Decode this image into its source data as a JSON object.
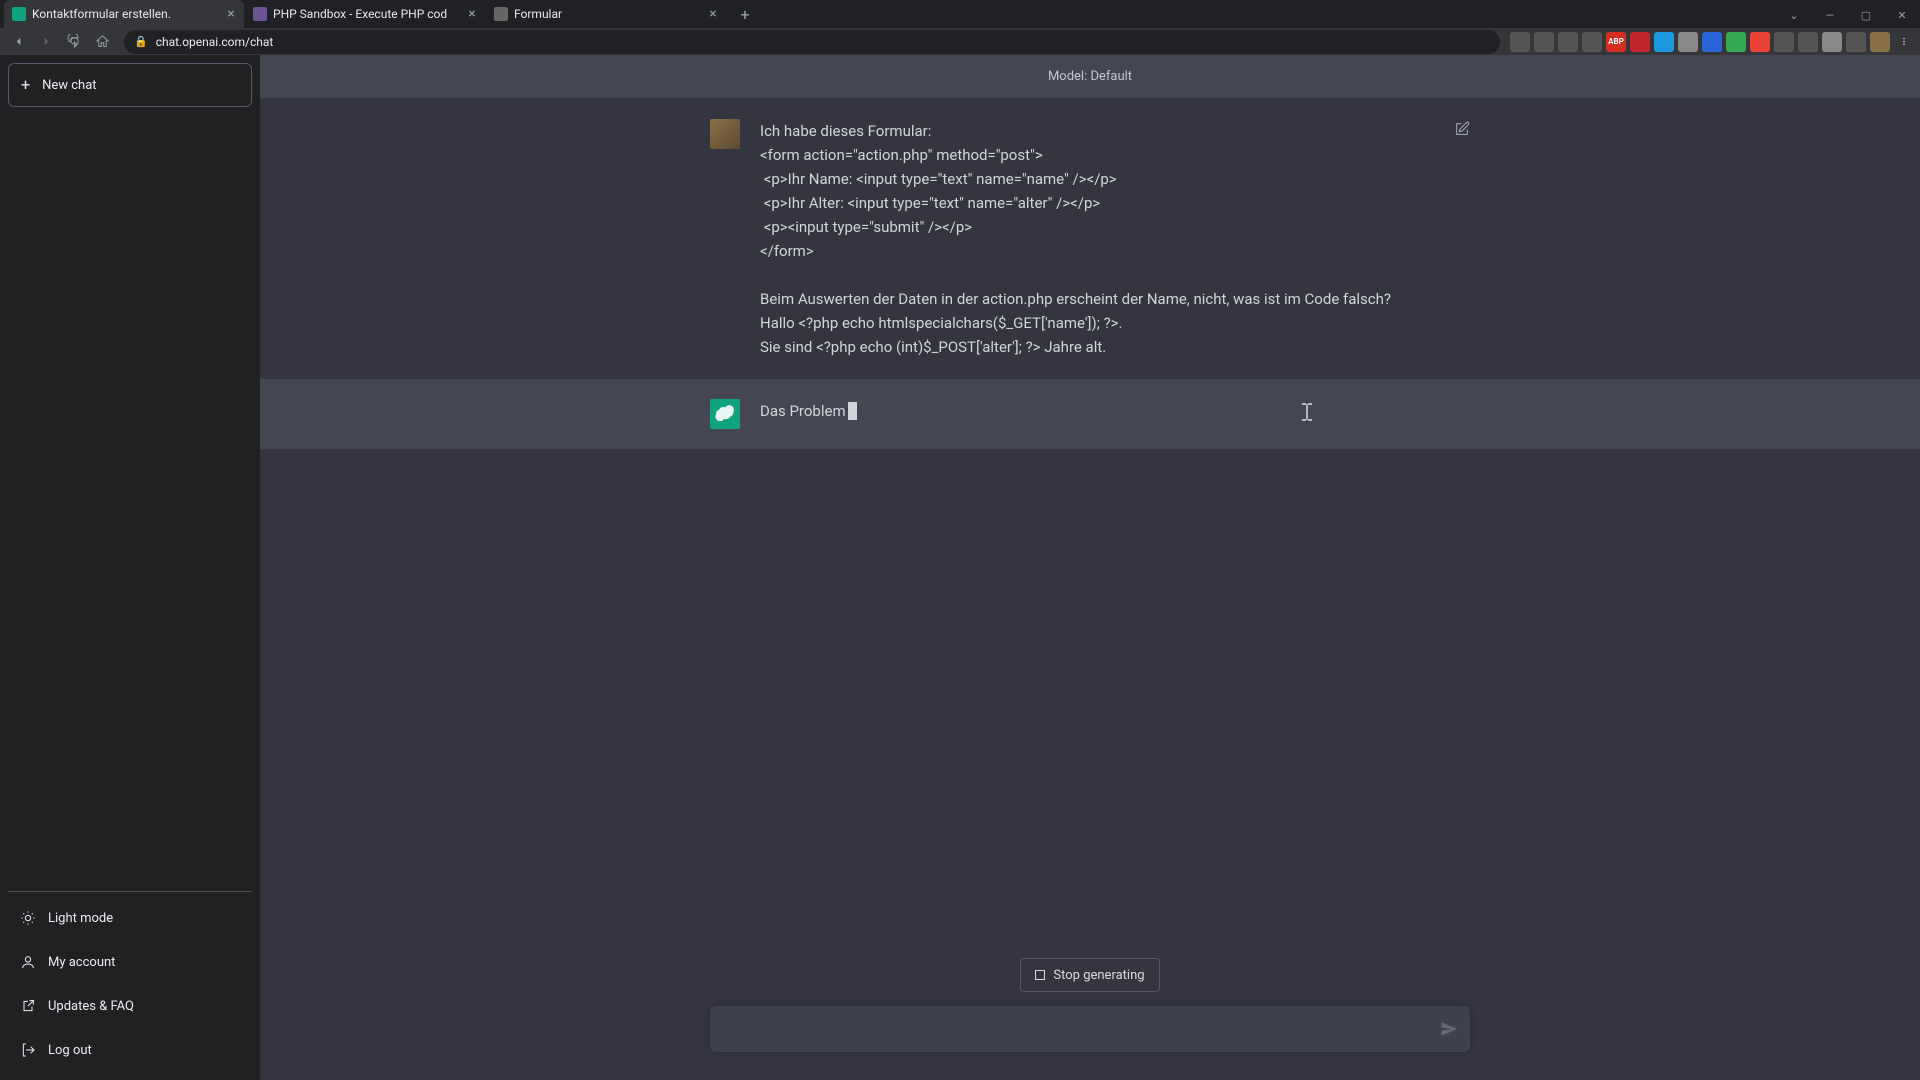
{
  "browser": {
    "tabs": [
      {
        "title": "Kontaktformular erstellen.",
        "favicon_bg": "#10a37f"
      },
      {
        "title": "PHP Sandbox - Execute PHP cod",
        "favicon_bg": "#6e5494"
      },
      {
        "title": "Formular",
        "favicon_bg": "#666"
      }
    ],
    "url": "chat.openai.com/chat",
    "window_controls": {
      "dropdown": "⌄",
      "min": "—",
      "max": "▢",
      "close": "✕"
    }
  },
  "extensions": [
    {
      "bg": "#555",
      "txt": ""
    },
    {
      "bg": "#555",
      "txt": ""
    },
    {
      "bg": "#555",
      "txt": ""
    },
    {
      "bg": "#555",
      "txt": ""
    },
    {
      "bg": "#d62d20",
      "txt": "ABP"
    },
    {
      "bg": "#c1272d",
      "txt": ""
    },
    {
      "bg": "#1b98e0",
      "txt": ""
    },
    {
      "bg": "#888",
      "txt": ""
    },
    {
      "bg": "#2a64d9",
      "txt": ""
    },
    {
      "bg": "#34a853",
      "txt": ""
    },
    {
      "bg": "#ea4335",
      "txt": ""
    },
    {
      "bg": "#555",
      "txt": ""
    },
    {
      "bg": "#555",
      "txt": ""
    },
    {
      "bg": "#888",
      "txt": ""
    },
    {
      "bg": "#555",
      "txt": ""
    },
    {
      "bg": "#8b6f47",
      "txt": ""
    },
    {
      "bg": "transparent",
      "txt": "⋮"
    }
  ],
  "sidebar": {
    "new_chat": "New chat",
    "footer": [
      {
        "label": "Light mode",
        "icon": "sun"
      },
      {
        "label": "My account",
        "icon": "user"
      },
      {
        "label": "Updates & FAQ",
        "icon": "external"
      },
      {
        "label": "Log out",
        "icon": "logout"
      }
    ]
  },
  "header": {
    "model_label": "Model: Default"
  },
  "conversation": {
    "user_message": "Ich habe dieses Formular:\n<form action=\"action.php\" method=\"post\">\n <p>Ihr Name: <input type=\"text\" name=\"name\" /></p>\n <p>Ihr Alter: <input type=\"text\" name=\"alter\" /></p>\n <p><input type=\"submit\" /></p>\n</form>\n\nBeim Auswerten der Daten in der action.php erscheint der Name, nicht, was ist im Code falsch?\nHallo <?php echo htmlspecialchars($_GET['name']); ?>.\nSie sind <?php echo (int)$_POST['alter']; ?> Jahre alt.",
    "assistant_partial": "Das Problem"
  },
  "controls": {
    "stop_label": "Stop generating",
    "input_placeholder": ""
  }
}
